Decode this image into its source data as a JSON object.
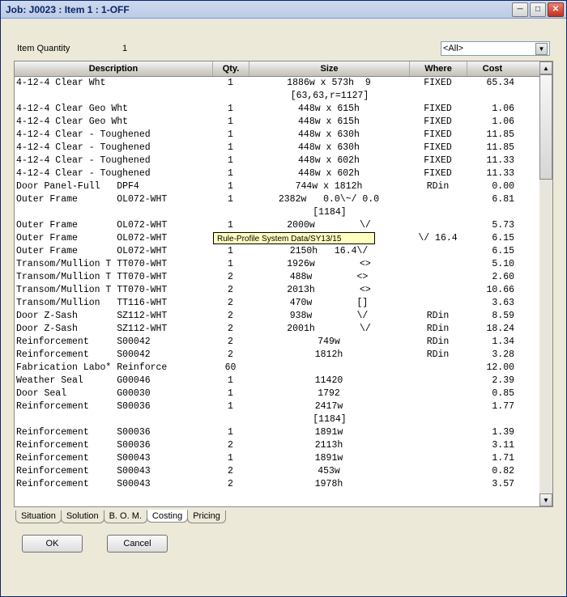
{
  "window": {
    "title": "Job: J0023   : Item  1 : 1-OFF"
  },
  "header": {
    "item_quantity_label": "Item Quantity",
    "item_quantity_value": "1",
    "filter_value": "<All>"
  },
  "columns": {
    "description": "Description",
    "qty": "Qty.",
    "size": "Size",
    "where": "Where",
    "cost": "Cost"
  },
  "rows": [
    {
      "desc": "4-12-4 Clear Wht",
      "qty": "1",
      "size": "1886w x 573h  9",
      "where": "FIXED",
      "cost": "65.34",
      "sub": "[63,63,r=1127]"
    },
    {
      "desc": "4-12-4 Clear Geo Wht",
      "qty": "1",
      "size": "448w x 615h",
      "where": "FIXED",
      "cost": "1.06"
    },
    {
      "desc": "4-12-4 Clear Geo Wht",
      "qty": "1",
      "size": "448w x 615h",
      "where": "FIXED",
      "cost": "1.06"
    },
    {
      "desc": "4-12-4 Clear - Toughened",
      "qty": "1",
      "size": "448w x 630h",
      "where": "FIXED",
      "cost": "11.85"
    },
    {
      "desc": "4-12-4 Clear - Toughened",
      "qty": "1",
      "size": "448w x 630h",
      "where": "FIXED",
      "cost": "11.85"
    },
    {
      "desc": "4-12-4 Clear - Toughened",
      "qty": "1",
      "size": "448w x 602h",
      "where": "FIXED",
      "cost": "11.33"
    },
    {
      "desc": "4-12-4 Clear - Toughened",
      "qty": "1",
      "size": "448w x 602h",
      "where": "FIXED",
      "cost": "11.33"
    },
    {
      "desc": "Door Panel-Full   DPF4",
      "qty": "1",
      "size": "744w x 1812h",
      "where": "RDin",
      "cost": "0.00"
    },
    {
      "desc": "Outer Frame       OL072-WHT",
      "qty": "1",
      "size": "2382w   0.0\\~/ 0.0",
      "where": "",
      "cost": "6.81",
      "sub": "[1184]"
    },
    {
      "desc": "Outer Frame       OL072-WHT",
      "qty": "1",
      "size": "2000w        \\/",
      "where": "",
      "cost": "5.73"
    },
    {
      "desc": "Outer Frame       OL072-WHT",
      "qty": "",
      "size": "",
      "where": "\\/ 16.4",
      "cost": "6.15",
      "tooltip": "Rule-Profile System Data/SY13/15"
    },
    {
      "desc": "Outer Frame       OL072-WHT",
      "qty": "1",
      "size": "2150h   16.4\\/",
      "where": "",
      "cost": "6.15"
    },
    {
      "desc": "Transom/Mullion T TT070-WHT",
      "qty": "1",
      "size": "1926w        <>",
      "where": "",
      "cost": "5.10"
    },
    {
      "desc": "Transom/Mullion T TT070-WHT",
      "qty": "2",
      "size": "488w        <>",
      "where": "",
      "cost": "2.60"
    },
    {
      "desc": "Transom/Mullion T TT070-WHT",
      "qty": "2",
      "size": "2013h        <>",
      "where": "",
      "cost": "10.66"
    },
    {
      "desc": "Transom/Mullion   TT116-WHT",
      "qty": "2",
      "size": "470w        []",
      "where": "",
      "cost": "3.63"
    },
    {
      "desc": "Door Z-Sash       SZ112-WHT",
      "qty": "2",
      "size": "938w        \\/",
      "where": "RDin",
      "cost": "8.59"
    },
    {
      "desc": "Door Z-Sash       SZ112-WHT",
      "qty": "2",
      "size": "2001h        \\/",
      "where": "RDin",
      "cost": "18.24"
    },
    {
      "desc": "Reinforcement     S00042",
      "qty": "2",
      "size": "749w",
      "where": "RDin",
      "cost": "1.34"
    },
    {
      "desc": "Reinforcement     S00042",
      "qty": "2",
      "size": "1812h",
      "where": "RDin",
      "cost": "3.28"
    },
    {
      "desc": "Fabrication Labo* Reinforce",
      "qty": "60",
      "size": "",
      "where": "",
      "cost": "12.00"
    },
    {
      "desc": "Weather Seal      G00046",
      "qty": "1",
      "size": "11420",
      "where": "",
      "cost": "2.39"
    },
    {
      "desc": "Door Seal         G00030",
      "qty": "1",
      "size": "1792",
      "where": "",
      "cost": "0.85"
    },
    {
      "desc": "Reinforcement     S00036",
      "qty": "1",
      "size": "2417w",
      "where": "",
      "cost": "1.77",
      "sub": "[1184]"
    },
    {
      "desc": "Reinforcement     S00036",
      "qty": "1",
      "size": "1891w",
      "where": "",
      "cost": "1.39"
    },
    {
      "desc": "Reinforcement     S00036",
      "qty": "2",
      "size": "2113h",
      "where": "",
      "cost": "3.11"
    },
    {
      "desc": "Reinforcement     S00043",
      "qty": "1",
      "size": "1891w",
      "where": "",
      "cost": "1.71"
    },
    {
      "desc": "Reinforcement     S00043",
      "qty": "2",
      "size": "453w",
      "where": "",
      "cost": "0.82"
    },
    {
      "desc": "Reinforcement     S00043",
      "qty": "2",
      "size": "1978h",
      "where": "",
      "cost": "3.57"
    }
  ],
  "tabs": [
    "Situation",
    "Solution",
    "B. O. M.",
    "Costing",
    "Pricing"
  ],
  "active_tab": "Costing",
  "buttons": {
    "ok": "OK",
    "cancel": "Cancel"
  }
}
